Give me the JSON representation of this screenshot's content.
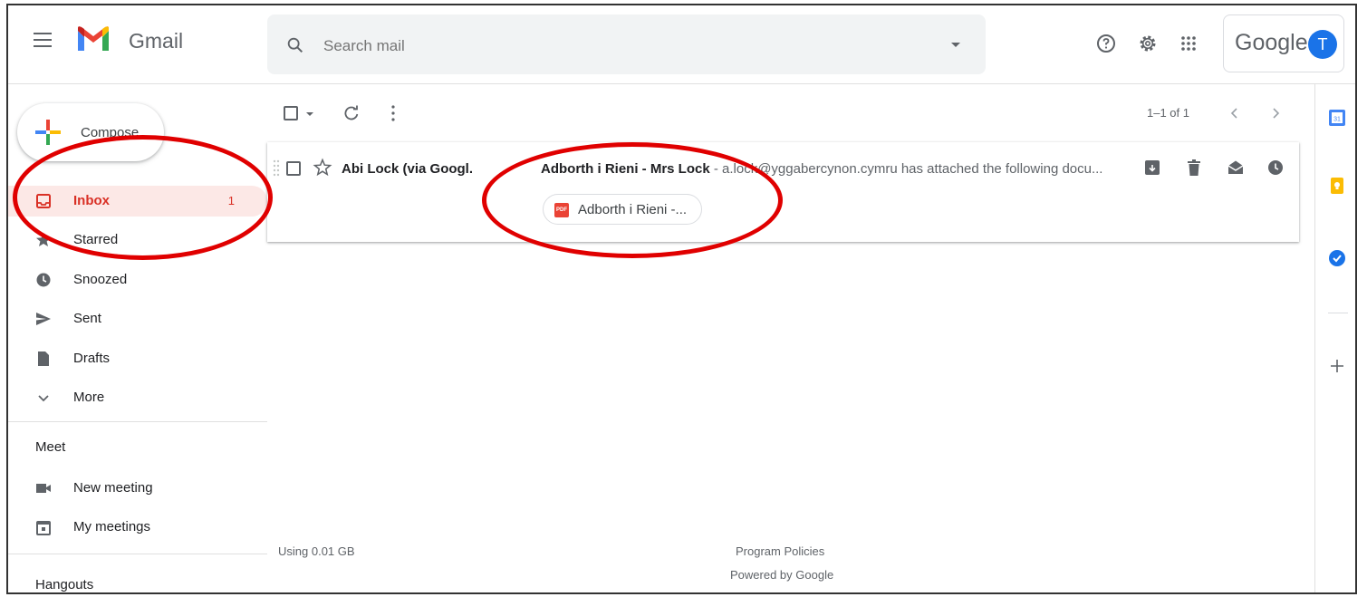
{
  "app": {
    "brand": "Gmail"
  },
  "search": {
    "placeholder": "Search mail"
  },
  "header": {
    "account_brand": "Google",
    "avatar_initial": "T"
  },
  "compose": {
    "label": "Compose"
  },
  "nav": {
    "items": [
      {
        "label": "Inbox",
        "count": "1",
        "icon": "inbox-icon",
        "active": true
      },
      {
        "label": "Starred",
        "icon": "star-icon"
      },
      {
        "label": "Snoozed",
        "icon": "clock-icon"
      },
      {
        "label": "Sent",
        "icon": "send-icon"
      },
      {
        "label": "Drafts",
        "icon": "draft-icon"
      },
      {
        "label": "More",
        "icon": "chevron-down-icon"
      }
    ],
    "meet": {
      "title": "Meet",
      "items": [
        {
          "label": "New meeting",
          "icon": "video-icon"
        },
        {
          "label": "My meetings",
          "icon": "calendar-icon"
        }
      ]
    },
    "hangouts_title": "Hangouts"
  },
  "toolbar": {
    "pager": "1–1 of 1"
  },
  "messages": [
    {
      "sender": "Abi Lock (via Googl.",
      "subject": "Adborth i Rieni - Mrs Lock",
      "snippet": " - a.lock@yggabercynon.cymru has attached the following docu...",
      "attachment": {
        "name": "Adborth i Rieni -...",
        "type": "PDF"
      }
    }
  ],
  "footer": {
    "storage": "Using 0.01 GB",
    "policies": "Program Policies",
    "powered": "Powered by Google"
  },
  "colors": {
    "accent_red": "#d93025",
    "annotation_red": "#e00000",
    "brand_blue": "#1a73e8"
  }
}
